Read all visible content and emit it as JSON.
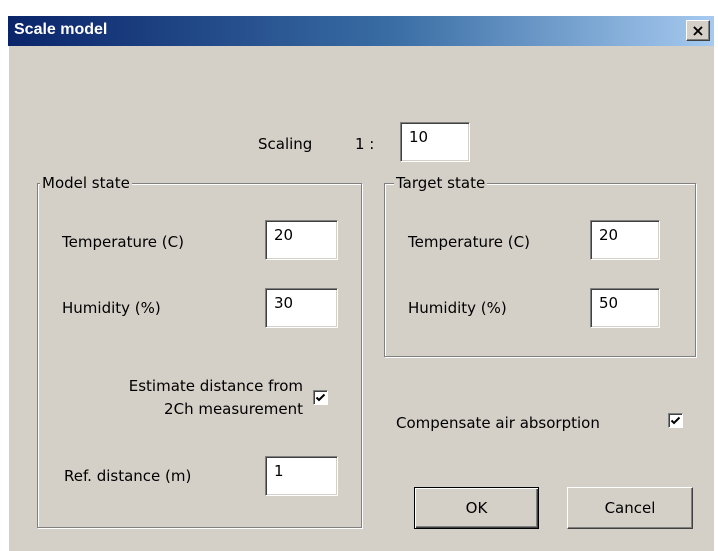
{
  "window": {
    "title": "Scale model",
    "close_glyph": "×"
  },
  "scaling": {
    "label": "Scaling",
    "ratio_prefix": "1 :",
    "value": "10"
  },
  "model_state": {
    "caption": "Model state",
    "temperature_label": "Temperature (C)",
    "temperature_value": "20",
    "humidity_label": "Humidity (%)",
    "humidity_value": "30",
    "estimate_label_line1": "Estimate distance from",
    "estimate_label_line2": "2Ch measurement",
    "estimate_checked": true,
    "ref_distance_label": "Ref. distance (m)",
    "ref_distance_value": "1"
  },
  "target_state": {
    "caption": "Target state",
    "temperature_label": "Temperature (C)",
    "temperature_value": "20",
    "humidity_label": "Humidity (%)",
    "humidity_value": "50"
  },
  "compensate": {
    "label": "Compensate air absorption",
    "checked": true
  },
  "buttons": {
    "ok": "OK",
    "cancel": "Cancel"
  }
}
